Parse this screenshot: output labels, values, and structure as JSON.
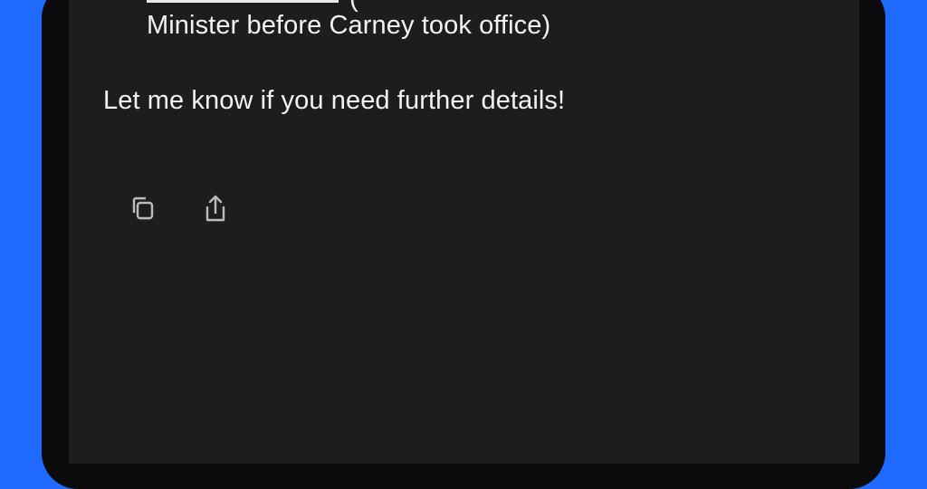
{
  "message": {
    "fragment_top": "(",
    "line_minister": "Minister before Carney took office)",
    "closing": "Let me know if you need further details!"
  },
  "actions": [
    {
      "icon": "copy-icon"
    },
    {
      "icon": "share-icon"
    }
  ],
  "colors": {
    "background": "#1f6bff",
    "screen": "#1d1d1d",
    "text": "#f2f2f2",
    "icon": "#bdbdbd"
  }
}
